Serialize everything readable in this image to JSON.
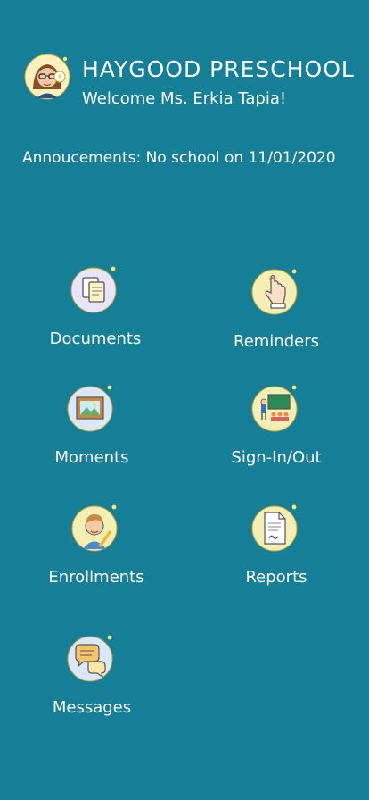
{
  "header": {
    "school_name": "HAYGOOD PRESCHOOL",
    "welcome": "Welcome  Ms.  Erkia Tapia!",
    "announcement": "Annoucements:  No school on 11/01/2020"
  },
  "menu": [
    {
      "label": "Documents",
      "icon": "documents-icon"
    },
    {
      "label": "Reminders",
      "icon": "reminders-icon"
    },
    {
      "label": "Moments",
      "icon": "moments-icon"
    },
    {
      "label": "Sign-In/Out",
      "icon": "sign-in-out-icon"
    },
    {
      "label": "Enrollments",
      "icon": "enrollments-icon"
    },
    {
      "label": "Reports",
      "icon": "reports-icon"
    },
    {
      "label": "Messages",
      "icon": "messages-icon"
    }
  ],
  "colors": {
    "background": "#167f98",
    "text": "#ffffff",
    "icon_circle_yellow": "#f6e7a8",
    "icon_circle_blue": "#dce8ff",
    "accent_yellow": "#ffe56a"
  }
}
